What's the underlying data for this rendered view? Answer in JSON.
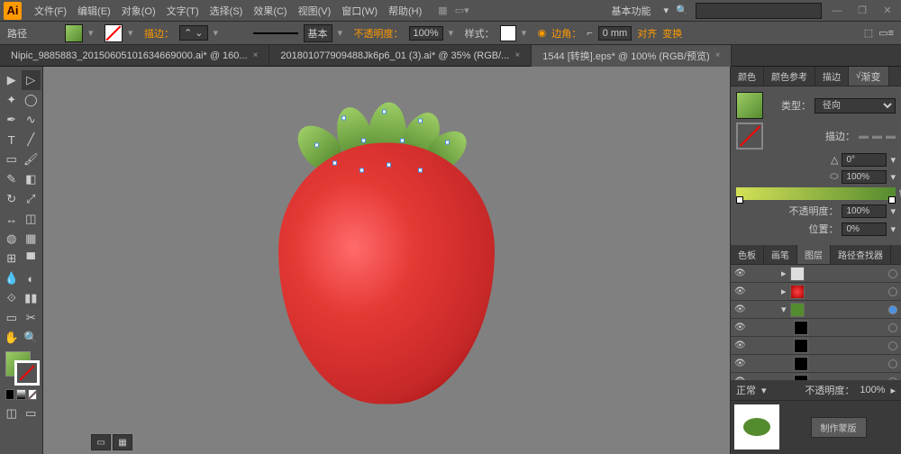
{
  "menu": {
    "items": [
      "文件(F)",
      "编辑(E)",
      "对象(O)",
      "文字(T)",
      "选择(S)",
      "效果(C)",
      "视图(V)",
      "窗口(W)",
      "帮助(H)"
    ],
    "workspace": "基本功能"
  },
  "control": {
    "path_label": "路径",
    "stroke": "描边：",
    "basic": "基本",
    "opacity": "不透明度：",
    "opacity_val": "100%",
    "style": "样式：",
    "corner": "边角：",
    "corner_val": "0 mm",
    "align": "对齐",
    "transform": "变换"
  },
  "tabs": [
    {
      "label": "Nipic_9885883_20150605101634669000.ai* @ 160...",
      "active": false
    },
    {
      "label": "201801077909488Jk6p6_01 (3).ai* @ 35% (RGB/...",
      "active": false
    },
    {
      "label": "1544 [转换].eps* @ 100% (RGB/预览)",
      "active": true
    }
  ],
  "gradient": {
    "tabs": [
      "颜色",
      "颜色参考",
      "描边"
    ],
    "active_tab": "渐变",
    "type_label": "类型：",
    "type_val": "径向",
    "stroke_label": "描边：",
    "angle_val": "0°",
    "ratio_val": "100%",
    "opacity_label": "不透明度：",
    "opacity_val": "100%",
    "pos_label": "位置：",
    "pos_val": "0%"
  },
  "layers": {
    "tabs": [
      "色板",
      "画笔",
      "图层",
      "路径查找器"
    ],
    "active": "图层",
    "opacity_label": "不透明度：",
    "opacity_val": "100%",
    "normal": "正常",
    "make": "制作蒙版"
  },
  "colors": {
    "fill": "linear-gradient(to bottom right,#9ccc65,#558b2f)",
    "green1": "#9ccc65",
    "green2": "#558b2f"
  }
}
